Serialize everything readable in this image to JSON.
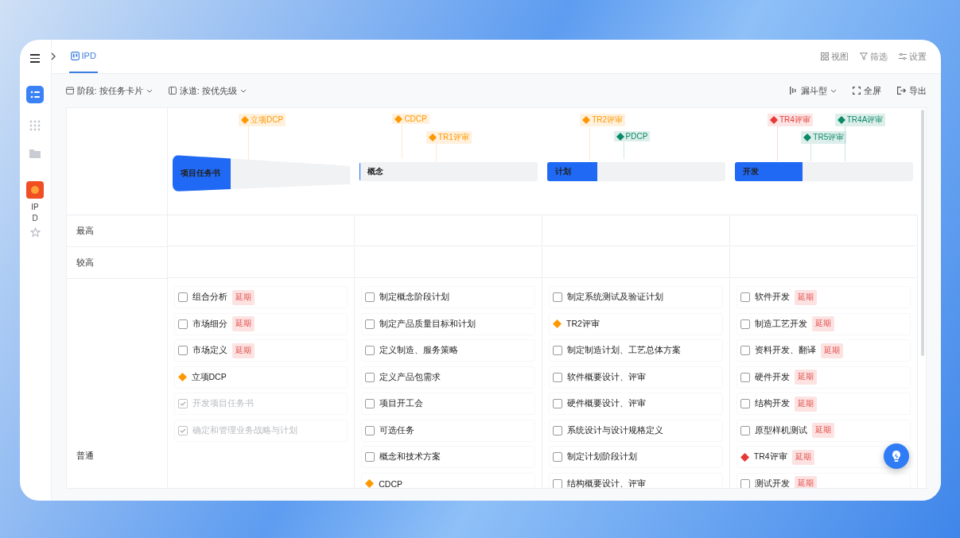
{
  "sidebar": {
    "app_label": "IPD"
  },
  "tabs": [
    {
      "label": "IPD",
      "selected": true
    }
  ],
  "header_actions": [
    "视图",
    "筛选",
    "设置"
  ],
  "toolbar": {
    "left": [
      {
        "label": "阶段: 按任务卡片",
        "kind": "stage"
      },
      {
        "label": "泳道: 按优先级",
        "kind": "lane"
      }
    ],
    "view_mode": "漏斗型",
    "fullscreen": "全屏",
    "export": "导出"
  },
  "stages": [
    {
      "name": "项目任务书",
      "level": 0.33,
      "milestones": [
        {
          "label": "立项DCP",
          "color": "#ff9800"
        }
      ]
    },
    {
      "name": "概念",
      "level": 0,
      "milestones": [
        {
          "label": "CDCP",
          "color": "#ff9800"
        },
        {
          "label": "TR1评审",
          "color": "#ff9800"
        }
      ]
    },
    {
      "name": "计划",
      "level": 0.28,
      "milestones": [
        {
          "label": "TR2评审",
          "color": "#ff9800"
        },
        {
          "label": "PDCP",
          "color": "#0b8a67"
        }
      ]
    },
    {
      "name": "开发",
      "level": 0.38,
      "milestones": [
        {
          "label": "TR4评审",
          "color": "#e53935"
        },
        {
          "label": "TR5评审",
          "color": "#0b8a67"
        },
        {
          "label": "TR4A评审",
          "color": "#0b8a67"
        }
      ]
    }
  ],
  "lanes": [
    {
      "label": "最高",
      "columns": [
        [],
        [],
        [],
        []
      ]
    },
    {
      "label": "较高",
      "columns": [
        [],
        [],
        [],
        []
      ]
    },
    {
      "label": "普通",
      "columns": [
        [
          {
            "kind": "task",
            "name": "组合分析",
            "checked": false,
            "tag": "延期"
          },
          {
            "kind": "task",
            "name": "市场细分",
            "checked": false,
            "tag": "延期"
          },
          {
            "kind": "task",
            "name": "市场定义",
            "checked": false,
            "tag": "延期"
          },
          {
            "kind": "milestone",
            "name": "立项DCP",
            "color": "#ff9800"
          },
          {
            "kind": "task",
            "name": "开发项目任务书",
            "checked": true
          },
          {
            "kind": "task",
            "name": "确定和管理业务战略与计划",
            "checked": true
          }
        ],
        [
          {
            "kind": "task",
            "name": "制定概念阶段计划",
            "checked": false
          },
          {
            "kind": "task",
            "name": "制定产品质量目标和计划",
            "checked": false
          },
          {
            "kind": "task",
            "name": "定义制造、服务策略",
            "checked": false
          },
          {
            "kind": "task",
            "name": "定义产品包需求",
            "checked": false
          },
          {
            "kind": "task",
            "name": "项目开工会",
            "checked": false
          },
          {
            "kind": "task",
            "name": "可选任务",
            "checked": false
          },
          {
            "kind": "task",
            "name": "概念和技术方案",
            "checked": false
          },
          {
            "kind": "milestone",
            "name": "CDCP",
            "color": "#ff9800"
          }
        ],
        [
          {
            "kind": "task",
            "name": "制定系统测试及验证计划",
            "checked": false
          },
          {
            "kind": "milestone",
            "name": "TR2评审",
            "color": "#ff9800"
          },
          {
            "kind": "task",
            "name": "制定制造计划、工艺总体方案",
            "checked": false
          },
          {
            "kind": "task",
            "name": "软件概要设计、评审",
            "checked": false
          },
          {
            "kind": "task",
            "name": "硬件概要设计、评审",
            "checked": false
          },
          {
            "kind": "task",
            "name": "系统设计与设计规格定义",
            "checked": false
          },
          {
            "kind": "task",
            "name": "制定计划阶段计划",
            "checked": false
          },
          {
            "kind": "task",
            "name": "结构概要设计、评审",
            "checked": false
          }
        ],
        [
          {
            "kind": "task",
            "name": "软件开发",
            "checked": false,
            "tag": "延期"
          },
          {
            "kind": "task",
            "name": "制造工艺开发",
            "checked": false,
            "tag": "延期"
          },
          {
            "kind": "task",
            "name": "资料开发、翻译",
            "checked": false,
            "tag": "延期"
          },
          {
            "kind": "task",
            "name": "硬件开发",
            "checked": false,
            "tag": "延期"
          },
          {
            "kind": "task",
            "name": "结构开发",
            "checked": false,
            "tag": "延期"
          },
          {
            "kind": "task",
            "name": "原型样机测试",
            "checked": false,
            "tag": "延期"
          },
          {
            "kind": "milestone",
            "name": "TR4评审",
            "color": "#e53935",
            "tag": "延期"
          },
          {
            "kind": "task",
            "name": "测试开发",
            "checked": false,
            "tag": "延期"
          }
        ]
      ]
    }
  ]
}
